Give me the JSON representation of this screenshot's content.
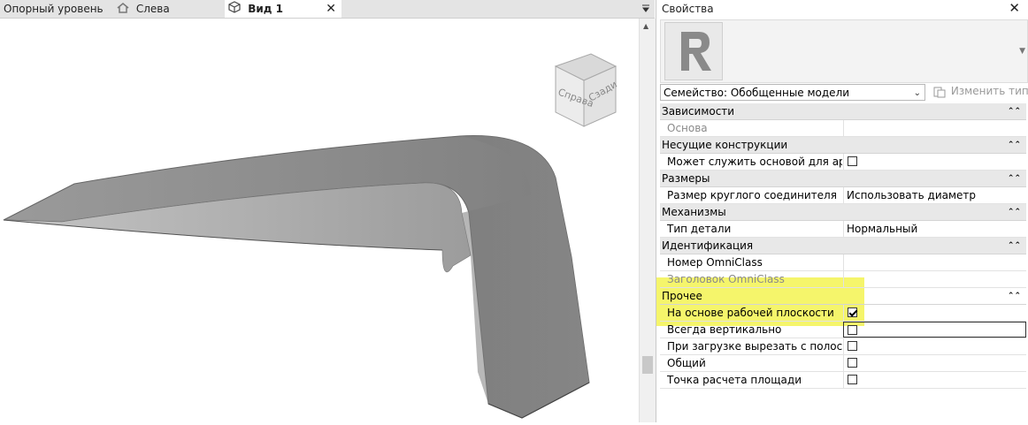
{
  "tabs": [
    {
      "label": "Опорный уровень",
      "icon": "none"
    },
    {
      "label": "Слева",
      "icon": "house-icon"
    },
    {
      "label": "Вид 1",
      "icon": "3d-cube-icon",
      "active": true,
      "close": "✕"
    }
  ],
  "viewcube": {
    "face_right": "Справа",
    "face_front": "Сзади"
  },
  "properties": {
    "title": "Свойства",
    "close": "✕",
    "family_select": "Семейство: Обобщенные модели",
    "edit_type_label": "Изменить тип",
    "groups": [
      {
        "name": "Зависимости",
        "rows": [
          {
            "name": "Основа",
            "value": "",
            "dim": true
          }
        ]
      },
      {
        "name": "Несущие конструкции",
        "rows": [
          {
            "name": "Может служить основой для арма...",
            "checkbox": true,
            "checked": false
          }
        ]
      },
      {
        "name": "Размеры",
        "rows": [
          {
            "name": "Размер круглого соединителя",
            "value": "Использовать диаметр"
          }
        ]
      },
      {
        "name": "Механизмы",
        "rows": [
          {
            "name": "Тип детали",
            "value": "Нормальный"
          }
        ]
      },
      {
        "name": "Идентификация",
        "rows": [
          {
            "name": "Номер OmniClass",
            "value": ""
          },
          {
            "name": "Заголовок OmniClass",
            "value": "",
            "dim": true
          }
        ]
      },
      {
        "name": "Прочее",
        "rows": [
          {
            "name": "На основе рабочей плоскости",
            "checkbox": true,
            "checked": true
          },
          {
            "name": "Всегда вертикально",
            "checkbox": true,
            "checked": false,
            "selected": true
          },
          {
            "name": "При загрузке вырезать с полостями",
            "checkbox": true,
            "checked": false
          },
          {
            "name": "Общий",
            "checkbox": true,
            "checked": false
          },
          {
            "name": "Точка расчета площади",
            "checkbox": true,
            "checked": false
          }
        ]
      }
    ]
  },
  "colors": {
    "highlight": "#f2f23a",
    "model_gray": "#8f8f8f"
  }
}
